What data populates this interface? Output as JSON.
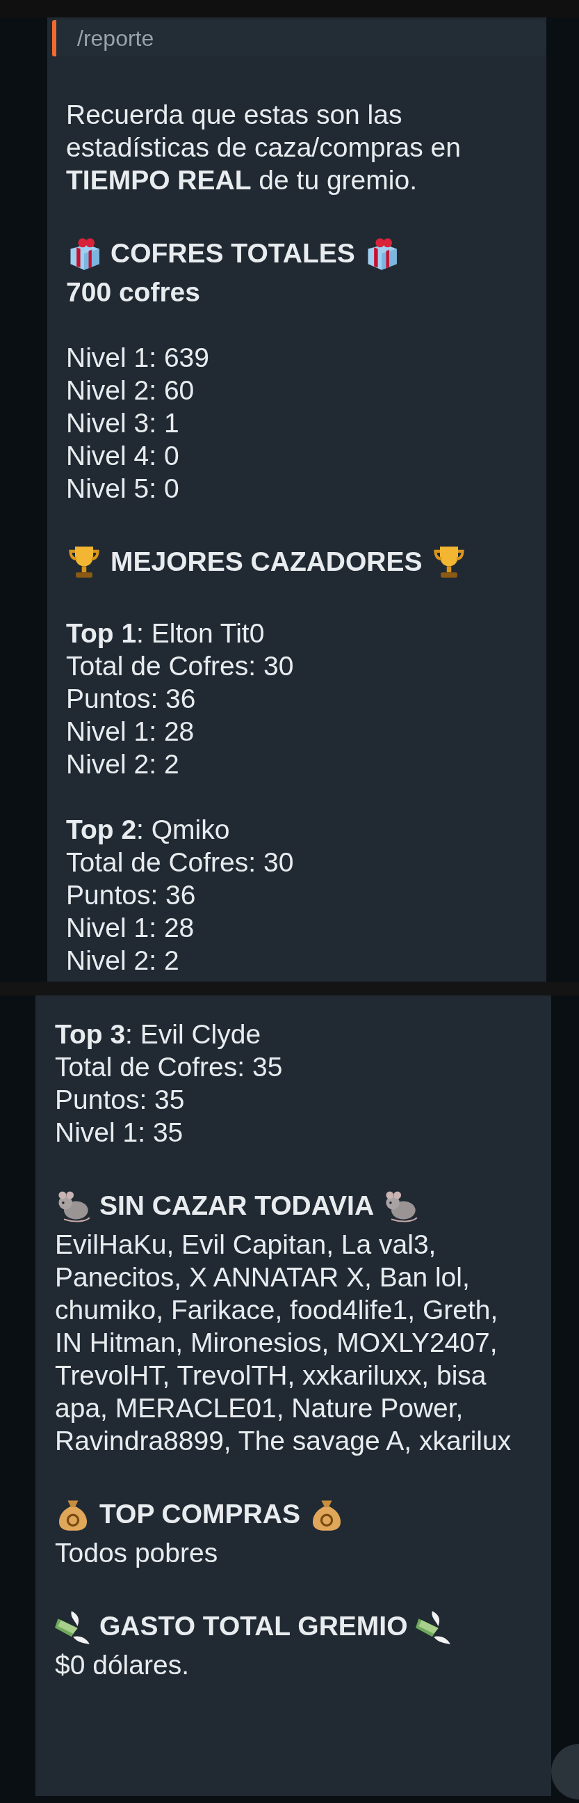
{
  "reply": {
    "text": "/reporte"
  },
  "panels": [
    {
      "sections": [
        {
          "kind": "intro",
          "text": "Recuerda que estas son las estadísticas de caza/compras en **TIEMPO REAL** de tu gremio."
        },
        {
          "kind": "chests",
          "title": "COFRES TOTALES",
          "total": "700 cofres",
          "groups": [
            [
              "Nivel 1: 639",
              "Nivel 2: 60",
              "Nivel 3: 1",
              "Nivel 4: 0",
              "Nivel 5: 0"
            ]
          ]
        },
        {
          "kind": "hunters",
          "title": "MEJORES CAZADORES",
          "groups": [
            [
              "**Top 1**: Elton Tit0",
              "Total de Cofres: 30",
              "Puntos: 36",
              "Nivel 1: 28",
              "Nivel 2: 2"
            ],
            [
              "**Top 2**: Qmiko",
              "Total de Cofres: 30",
              "Puntos: 36",
              "Nivel 1: 28",
              "Nivel 2: 2"
            ]
          ]
        }
      ]
    },
    {
      "sections": [
        {
          "kind": "hunters",
          "groups": [
            [
              "**Top 3**: Evil Clyde",
              "Total de Cofres: 35",
              "Puntos: 35",
              "Nivel 1: 35"
            ]
          ]
        },
        {
          "kind": "idle",
          "title": "SIN CAZAR TODAVIA",
          "text": "EvilHaKu, Evil Capitan, La val3, Panecitos, X ANNATAR X, Ban lol, chumiko, Farikace, food4life1, Greth, IN Hitman, Mironesios, MOXLY2407, TrevolHT, TrevolTH, xxkariluxx, bisa apa, MERACLE01, Nature Power, Ravindra8899, The savage A, xkarilux"
        },
        {
          "kind": "purchases",
          "title": "TOP COMPRAS",
          "text": "Todos pobres"
        },
        {
          "kind": "spending",
          "title": "GASTO TOTAL GREMIO",
          "text": "$0 dólares."
        }
      ]
    }
  ]
}
